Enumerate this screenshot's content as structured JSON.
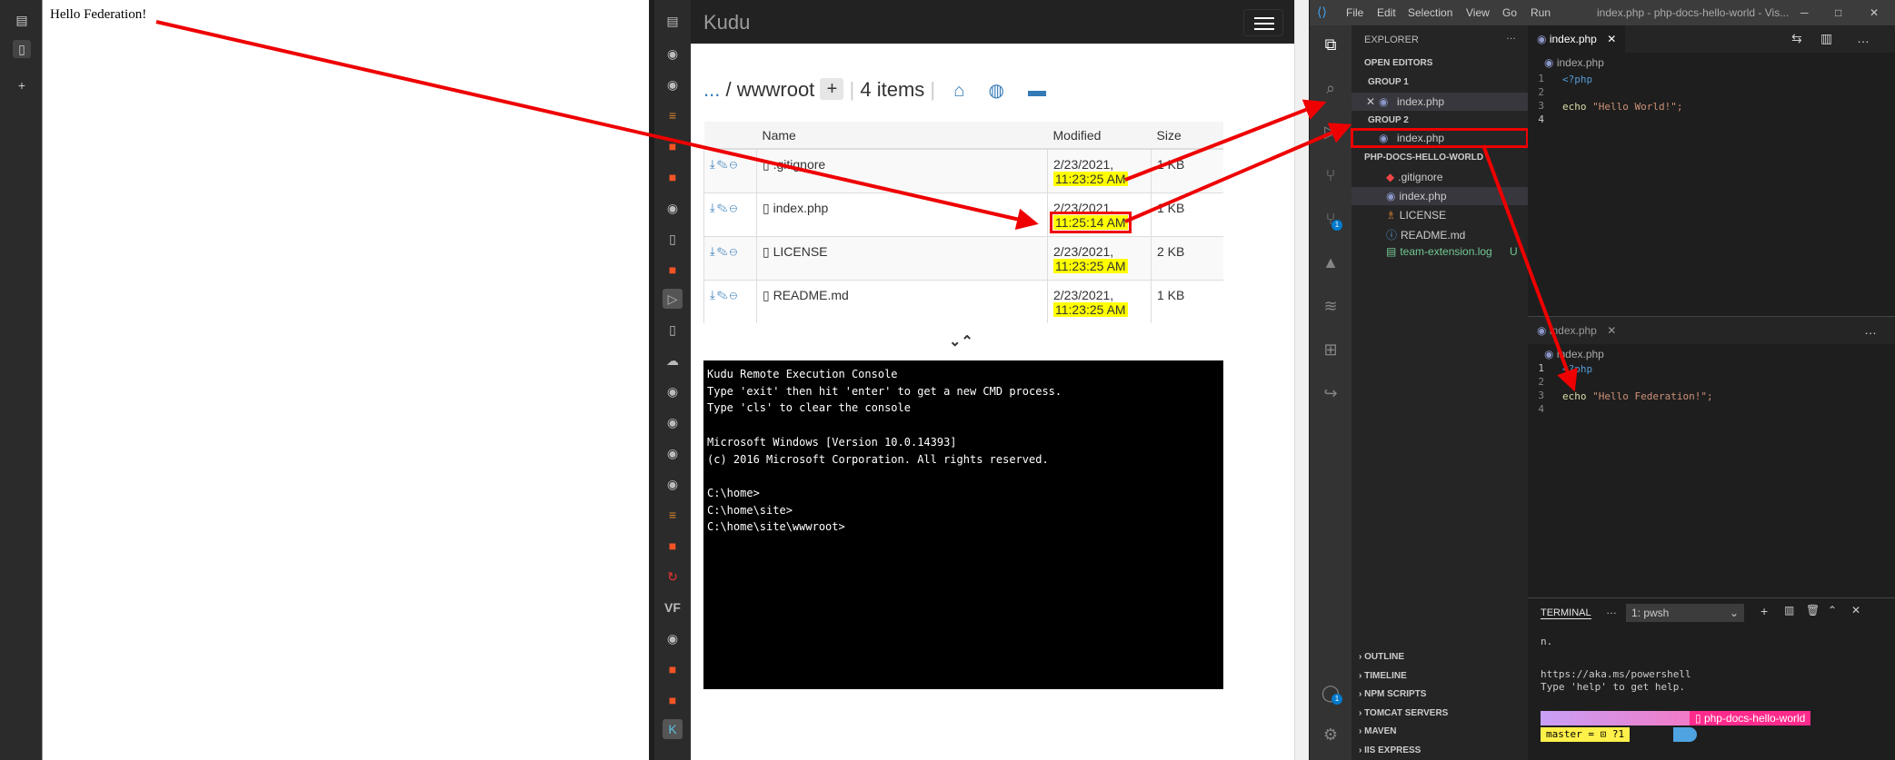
{
  "left_browser": {
    "page_text": "Hello Federation!"
  },
  "kudu": {
    "brand": "Kudu",
    "breadcrumb_dots": "...",
    "breadcrumb_sep": "/",
    "breadcrumb_folder": "wwwroot",
    "plus": "+",
    "items_count": "4 items",
    "columns": [
      "Name",
      "Modified",
      "Size"
    ],
    "files": [
      {
        "name": ".gitignore",
        "date": "2/23/2021,",
        "time": "11:23:25 AM",
        "size": "1 KB"
      },
      {
        "name": "index.php",
        "date": "2/23/2021,",
        "time": "11:25:14 AM",
        "size": "1 KB"
      },
      {
        "name": "LICENSE",
        "date": "2/23/2021,",
        "time": "11:23:25 AM",
        "size": "2 KB"
      },
      {
        "name": "README.md",
        "date": "2/23/2021,",
        "time": "11:23:25 AM",
        "size": "1 KB"
      }
    ],
    "collapse_chevrons": "⌄⌃",
    "console_lines": [
      "Kudu Remote Execution Console",
      "Type 'exit' then hit 'enter' to get a new CMD process.",
      "Type 'cls' to clear the console",
      "",
      "Microsoft Windows [Version 10.0.14393]",
      "(c) 2016 Microsoft Corporation. All rights reserved.",
      "",
      "C:\\home>",
      "C:\\home\\site>",
      "C:\\home\\site\\wwwroot>"
    ]
  },
  "vscode": {
    "menu": [
      "File",
      "Edit",
      "Selection",
      "View",
      "Go",
      "Run"
    ],
    "title": "index.php - php-docs-hello-world - Vis...",
    "explorer_title": "EXPLORER",
    "open_editors": "OPEN EDITORS",
    "group1": "GROUP 1",
    "group1_file": "index.php",
    "group2": "GROUP 2",
    "group2_file": "index.php",
    "project": "PHP-DOCS-HELLO-WORLD",
    "tree": [
      ".gitignore",
      "index.php",
      "LICENSE",
      "README.md",
      "team-extension.log"
    ],
    "untracked_badge": "U",
    "panels": [
      "OUTLINE",
      "TIMELINE",
      "NPM SCRIPTS",
      "TOMCAT SERVERS",
      "MAVEN",
      "IIS EXPRESS"
    ],
    "editor1": {
      "tab": "index.php",
      "crumb": "index.php",
      "line1": "<?php",
      "line3_kw": "echo",
      "line3_str": "\"Hello World!\";"
    },
    "editor2": {
      "tab": "index.php",
      "crumb": "index.php",
      "line1": "<?php",
      "line3_kw": "echo",
      "line3_str": "\"Hello Federation!\";"
    },
    "line_numbers": [
      "1",
      "2",
      "3",
      "4"
    ],
    "terminal": {
      "tab": "TERMINAL",
      "shell": "1: pwsh",
      "line1": "n.",
      "line2": "https://aka.ms/powershell",
      "line3": "Type 'help' to get help.",
      "prompt_repo": "php-docs-hello-world",
      "prompt_branch": "master = ⊡ ?1"
    },
    "badges": {
      "git": "1",
      "account": "1"
    },
    "colors": {
      "accent": "#007acc",
      "highlight": "#ffff00",
      "arrow": "#ff0000"
    }
  }
}
